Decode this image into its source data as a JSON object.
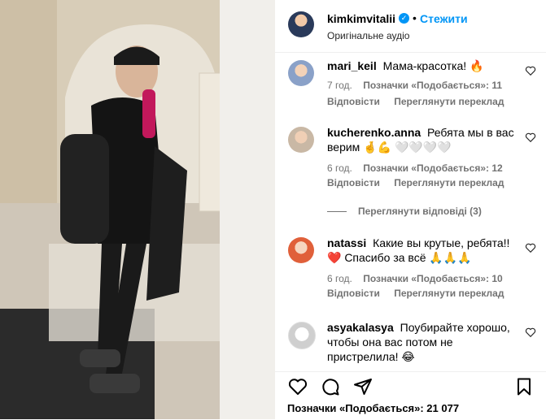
{
  "post": {
    "username": "kimkimvitalii",
    "separator": "•",
    "follow_label": "Стежити",
    "audio": "Оригінальне аудіо"
  },
  "comments": [
    {
      "user": "mari_keil",
      "text": "Мама-красотка! 🔥",
      "time": "7 год.",
      "likes": "Позначки «Подобається»: 11",
      "reply": "Відповісти",
      "translate": "Переглянути переклад"
    },
    {
      "user": "kucherenko.anna",
      "text": "Ребята мы в вас верим 🤞💪 🤍🤍🤍🤍",
      "time": "6 год.",
      "likes": "Позначки «Подобається»: 12",
      "reply": "Відповісти",
      "translate": "Переглянути переклад"
    },
    {
      "user": "natassi",
      "text": "Какие вы крутые, ребята!! ❤️ Спасибо за всё 🙏🙏🙏",
      "time": "6 год.",
      "likes": "Позначки «Подобається»: 10",
      "reply": "Відповісти",
      "translate": "Переглянути переклад"
    },
    {
      "user": "asyakalasya",
      "text": "Поубирайте хорошо, чтобы она вас потом не пристрелила! 😂",
      "time": "",
      "likes": "",
      "reply": "",
      "translate": ""
    }
  ],
  "view_replies": "Переглянути відповіді (3)",
  "footer": {
    "likes_label": "Позначки «Подобається»: 21 077"
  },
  "colors": {
    "accent": "#0095f6",
    "muted": "#737373"
  },
  "icons": [
    "heart-icon",
    "comment-icon",
    "share-icon",
    "bookmark-icon",
    "verified-icon"
  ]
}
